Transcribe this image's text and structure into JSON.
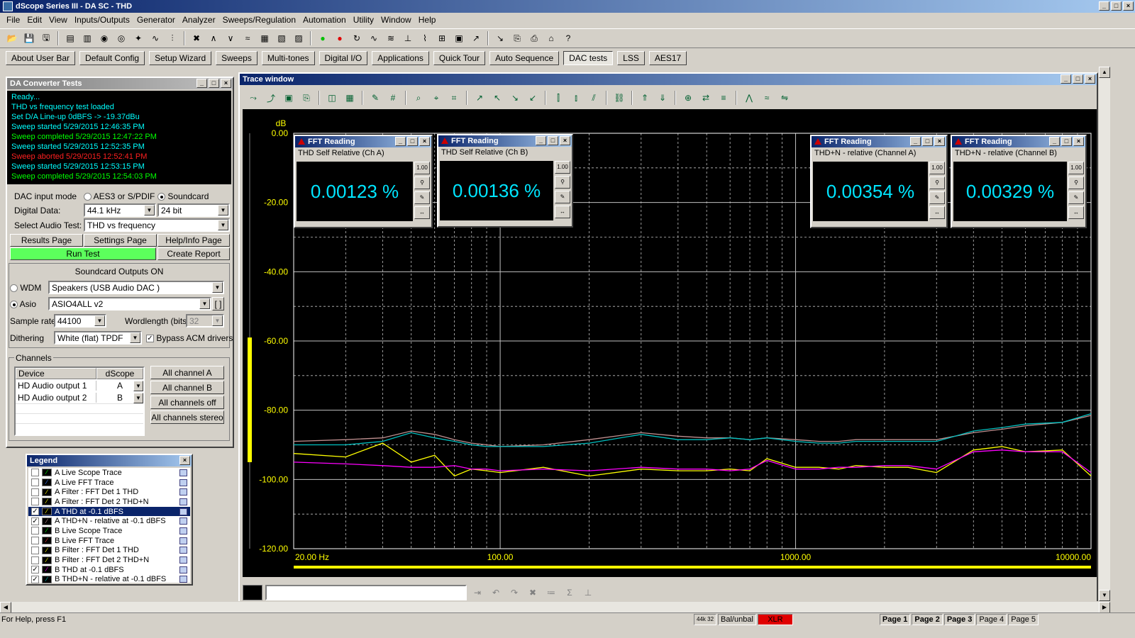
{
  "app": {
    "title": "dScope Series III - DA SC - THD"
  },
  "menu": [
    "File",
    "Edit",
    "View",
    "Inputs/Outputs",
    "Generator",
    "Analyzer",
    "Sweeps/Regulation",
    "Automation",
    "Utility",
    "Window",
    "Help"
  ],
  "userbar": [
    "About User Bar",
    "Default Config",
    "Setup Wizard",
    "Sweeps",
    "Multi-tones",
    "Digital I/O",
    "Applications",
    "Quick Tour",
    "Auto Sequence",
    "DAC tests",
    "LSS",
    "AES17"
  ],
  "dac": {
    "title": "DA Converter Tests",
    "status": "Ready...",
    "log": [
      {
        "text": "THD vs frequency test loaded",
        "color": "#00ffff"
      },
      {
        "text": "Set D/A Line-up 0dBFS -> -19.37dBu",
        "color": "#00ffff"
      },
      {
        "text": "Sweep started 5/29/2015 12:46:35 PM",
        "color": "#00ffff"
      },
      {
        "text": "Sweep completed 5/29/2015 12:47:22 PM",
        "color": "#00ff00"
      },
      {
        "text": "Sweep started 5/29/2015 12:52:35 PM",
        "color": "#00ffff"
      },
      {
        "text": "Sweep aborted 5/29/2015 12:52:41 PM",
        "color": "#ff2020"
      },
      {
        "text": "Sweep started 5/29/2015 12:53:15 PM",
        "color": "#00ffff"
      },
      {
        "text": "Sweep completed 5/29/2015 12:54:03 PM",
        "color": "#00ff00"
      }
    ],
    "input_mode_label": "DAC input mode",
    "input_mode_opt1": "AES3 or S/PDIF",
    "input_mode_opt2": "Soundcard",
    "digital_data_label": "Digital Data:",
    "sample_rate": "44.1 kHz",
    "bit_depth": "24 bit",
    "audio_test_label": "Select Audio Test:",
    "audio_test": "THD vs frequency",
    "results_page": "Results Page",
    "settings_page": "Settings Page",
    "help_page": "Help/Info Page",
    "run_test": "Run Test",
    "create_report": "Create Report",
    "soundcard_title": "Soundcard Outputs ON",
    "wdm_label": "WDM",
    "wdm_device": "Speakers (USB Audio DAC   )",
    "asio_label": "Asio",
    "asio_device": "ASIO4ALL v2",
    "asio_btn": "[ ]",
    "sample_rate_label": "Sample rate",
    "sample_rate_val": "44100",
    "wordlength_label": "Wordlength (bits)",
    "wordlength_val": "32",
    "dithering_label": "Dithering",
    "dithering_val": "White (flat) TPDF",
    "bypass_label": "Bypass ACM drivers",
    "channels_label": "Channels",
    "col_device": "Device",
    "col_dscope": "dScope",
    "channels": [
      {
        "device": "HD Audio output 1",
        "dscope": "A"
      },
      {
        "device": "HD Audio output 2",
        "dscope": "B"
      }
    ],
    "all_a": "All channel A",
    "all_b": "All channel B",
    "all_off": "All channels off",
    "all_stereo": "All channels stereo"
  },
  "legend": {
    "title": "Legend",
    "items": [
      {
        "label": "A  Live Scope Trace",
        "checked": false,
        "sel": false,
        "color": "#00ff00"
      },
      {
        "label": "A  Live FFT Trace",
        "checked": false,
        "sel": false,
        "color": "#4080ff"
      },
      {
        "label": "A  Filter : FFT Det 1 THD",
        "checked": false,
        "sel": false,
        "color": "#ffff00"
      },
      {
        "label": "A  Filter : FFT Det 2 THD+N",
        "checked": false,
        "sel": false,
        "color": "#ffff00"
      },
      {
        "label": "A  THD  at -0.1 dBFS",
        "checked": true,
        "sel": true,
        "color": "#ffff00"
      },
      {
        "label": "A  THD+N - relative  at -0.1 dBFS",
        "checked": true,
        "sel": false,
        "color": "#c09090"
      },
      {
        "label": "B  Live Scope Trace",
        "checked": false,
        "sel": false,
        "color": "#00ff00"
      },
      {
        "label": "B  Live FFT Trace",
        "checked": false,
        "sel": false,
        "color": "#ff4040"
      },
      {
        "label": "B  Filter : FFT Det 1 THD",
        "checked": false,
        "sel": false,
        "color": "#ffff00"
      },
      {
        "label": "B  Filter : FFT Det 2 THD+N",
        "checked": false,
        "sel": false,
        "color": "#ffff00"
      },
      {
        "label": "B  THD  at -0.1 dBFS",
        "checked": true,
        "sel": false,
        "color": "#ff00ff"
      },
      {
        "label": "B  THD+N - relative  at -0.1 dBFS",
        "checked": true,
        "sel": false,
        "color": "#00c0c0"
      }
    ]
  },
  "trace": {
    "title": "Trace window"
  },
  "fft": [
    {
      "title": "FFT Reading",
      "label": "THD Self Relative (Ch A)",
      "value": "0.00123 %"
    },
    {
      "title": "FFT Reading",
      "label": "THD Self Relative (Ch B)",
      "value": "0.00136 %"
    },
    {
      "title": "FFT Reading",
      "label": "THD+N - relative (Channel A)",
      "value": "0.00354 %"
    },
    {
      "title": "FFT Reading",
      "label": "THD+N - relative (Channel B)",
      "value": "0.00329 %"
    }
  ],
  "chart_data": {
    "type": "line",
    "ylabel": "dB",
    "ylim": [
      -120,
      0
    ],
    "yticks": [
      "0.00",
      "-20.00",
      "-40.00",
      "-60.00",
      "-80.00",
      "-100.00",
      "-120.00"
    ],
    "xscale": "log",
    "xlim": [
      20,
      10000
    ],
    "xticks": [
      "20.00 Hz",
      "100.00",
      "1000.00",
      "10000.00"
    ],
    "grid": true,
    "series": [
      {
        "color": "#ffff00",
        "x": [
          20,
          30,
          40,
          50,
          60,
          70,
          80,
          90,
          100,
          140,
          200,
          300,
          400,
          500,
          600,
          700,
          800,
          1000,
          1200,
          1400,
          1600,
          2000,
          2400,
          3000,
          4000,
          5000,
          6000,
          8000,
          10000
        ],
        "y": [
          -92.5,
          -93.5,
          -89.5,
          -95,
          -93,
          -99,
          -97,
          -97.5,
          -98,
          -96.5,
          -99,
          -97,
          -97.5,
          -97.5,
          -97,
          -97.5,
          -94,
          -96.5,
          -96.5,
          -97,
          -96,
          -96.5,
          -96.5,
          -98,
          -91.5,
          -90.5,
          -92,
          -91.5,
          -99
        ]
      },
      {
        "color": "#ff00ff",
        "x": [
          20,
          30,
          40,
          50,
          60,
          70,
          80,
          90,
          100,
          140,
          200,
          300,
          400,
          500,
          600,
          700,
          800,
          1000,
          1200,
          1400,
          1600,
          2000,
          2400,
          3000,
          4000,
          5000,
          6000,
          8000,
          10000
        ],
        "y": [
          -95,
          -95.5,
          -96,
          -96.5,
          -96.5,
          -96,
          -97,
          -97,
          -97.5,
          -97,
          -97.5,
          -96.5,
          -97,
          -97,
          -97.5,
          -97,
          -94.5,
          -97,
          -97,
          -96.5,
          -96.5,
          -96,
          -96,
          -97,
          -92,
          -91.5,
          -92,
          -92,
          -98
        ]
      },
      {
        "color": "#c09090",
        "x": [
          20,
          30,
          40,
          50,
          60,
          70,
          80,
          90,
          100,
          140,
          200,
          300,
          400,
          500,
          600,
          700,
          800,
          1000,
          1200,
          1400,
          1600,
          2000,
          2400,
          3000,
          4000,
          5000,
          6000,
          8000,
          10000
        ],
        "y": [
          -89,
          -88.5,
          -88,
          -86,
          -87,
          -88.5,
          -89.5,
          -90,
          -90.5,
          -90,
          -88.5,
          -86.5,
          -87.5,
          -88,
          -88,
          -88.5,
          -88,
          -88.5,
          -89,
          -89,
          -88.5,
          -88.5,
          -88.5,
          -88.5,
          -86.5,
          -85.5,
          -84.5,
          -83.5,
          -81.5
        ]
      },
      {
        "color": "#00c0c0",
        "x": [
          20,
          30,
          40,
          50,
          60,
          70,
          80,
          90,
          100,
          140,
          200,
          300,
          400,
          500,
          600,
          700,
          800,
          1000,
          1200,
          1400,
          1600,
          2000,
          2400,
          3000,
          4000,
          5000,
          6000,
          8000,
          10000
        ],
        "y": [
          -90,
          -90,
          -89,
          -86.5,
          -88,
          -89,
          -90,
          -90.5,
          -90.5,
          -90.5,
          -89.5,
          -87,
          -88.5,
          -88.5,
          -88,
          -88.5,
          -88,
          -89,
          -89.5,
          -89.5,
          -89,
          -89,
          -89,
          -89,
          -86,
          -85,
          -84,
          -83.5,
          -81
        ]
      }
    ]
  },
  "status": {
    "help": "For Help, press F1",
    "rate": "44k 32",
    "bal": "Bal/unbal",
    "xlr": "XLR",
    "pages": [
      "Page 1",
      "Page 2",
      "Page 3",
      "Page 4",
      "Page 5"
    ]
  }
}
